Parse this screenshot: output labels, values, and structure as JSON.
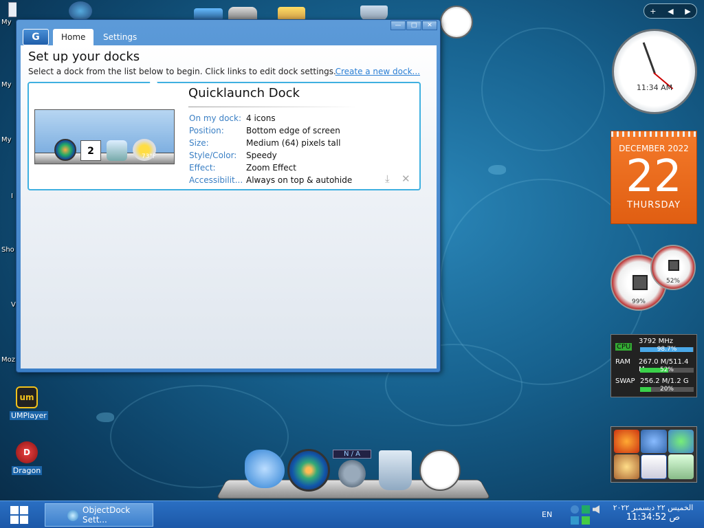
{
  "desktop": {
    "left_labels": [
      "My",
      "My",
      "My",
      "I",
      "Sho",
      "V",
      "Moz"
    ],
    "icons": [
      {
        "label": "UMPlayer",
        "glyph": "um"
      },
      {
        "label": "Dragon",
        "glyph": "D"
      }
    ]
  },
  "window": {
    "logo": "G",
    "tabs": [
      {
        "label": "Home"
      },
      {
        "label": "Settings"
      }
    ],
    "buttons": {
      "minimize": "—",
      "restore": "□",
      "close": "✕"
    },
    "title": "Set up your docks",
    "subtitle": "Select a dock from the list below to begin. Click links to edit dock settings.",
    "create_link": "Create a new dock...",
    "dock": {
      "name": "Quicklaunch Dock",
      "preview_calendar": "2",
      "preview_temp": "73°F",
      "properties": [
        {
          "label": "On my dock:",
          "value": "4 icons"
        },
        {
          "label": "Position:",
          "value": "Bottom edge of screen"
        },
        {
          "label": "Size:",
          "value": "Medium (64) pixels tall"
        },
        {
          "label": "Style/Color:",
          "value": "Speedy"
        },
        {
          "label": "Effect:",
          "value": "Zoom Effect"
        },
        {
          "label": "Accessibilit...",
          "value": "Always on top & autohide"
        }
      ]
    }
  },
  "widgets": {
    "nav": {
      "add": "+",
      "prev": "◀",
      "next": "▶"
    },
    "clock_time": "11:34 AM",
    "calendar": {
      "month_year": "DECEMBER 2022",
      "day": "22",
      "weekday": "THURSDAY"
    },
    "gauges": {
      "cpu": "99%",
      "ram": "52%"
    },
    "sysmon": {
      "cpu": {
        "name": "CPU",
        "value": "3792 MHz",
        "pct": "98.7%",
        "fill": 0.987
      },
      "ram": {
        "name": "RAM",
        "value": "267.0 M/511.4 M",
        "pct": "52%",
        "fill": 0.52
      },
      "swap": {
        "name": "SWAP",
        "value": "256.2 M/1.2 G",
        "pct": "20%",
        "fill": 0.2
      }
    }
  },
  "bottom_dock": {
    "na_label": "N / A"
  },
  "taskbar": {
    "task_label": "ObjectDock Sett...",
    "language": "EN",
    "date": "الخميس ٢٢ ديسمبر ٢٠٢٢",
    "time": "ص 11:34:52"
  }
}
